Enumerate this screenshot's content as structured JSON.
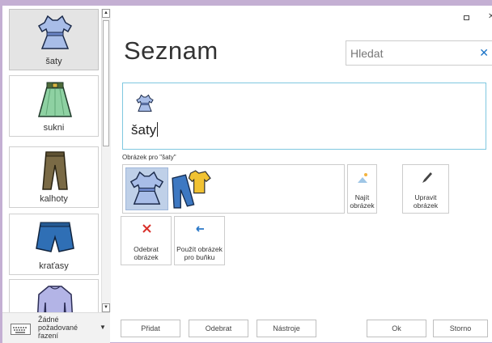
{
  "window": {
    "maximize_icon": "maximize-icon",
    "close_icon": "close-icon"
  },
  "sidebar": {
    "items": [
      {
        "label": "šaty",
        "icon": "dress-icon"
      },
      {
        "label": "sukni",
        "icon": "skirt-icon"
      },
      {
        "label": "kalhoty",
        "icon": "trousers-icon"
      },
      {
        "label": "kraťasy",
        "icon": "shorts-icon"
      },
      {
        "label": "",
        "icon": "sweater-icon"
      }
    ],
    "sort": {
      "label": "Žádné požadované řazení",
      "icon": "keyboard-icon"
    }
  },
  "header": {
    "title": "Seznam"
  },
  "search": {
    "placeholder": "Hledat"
  },
  "editor": {
    "text": "šaty",
    "icon": "dress-icon"
  },
  "pictures": {
    "label": "Obrázek pro \"šaty\"",
    "items": [
      {
        "icon": "dress-icon",
        "selected": true
      },
      {
        "icon": "clothes-icon",
        "selected": false
      }
    ]
  },
  "actions": {
    "find": "Najít obrázek",
    "edit": "Upravit obrázek",
    "remove": "Odebrat obrázek",
    "use": "Použít obrázek pro buňku"
  },
  "footer": {
    "add": "Přidat",
    "delete": "Odebrat",
    "tools": "Nástroje",
    "ok": "Ok",
    "cancel": "Storno"
  }
}
